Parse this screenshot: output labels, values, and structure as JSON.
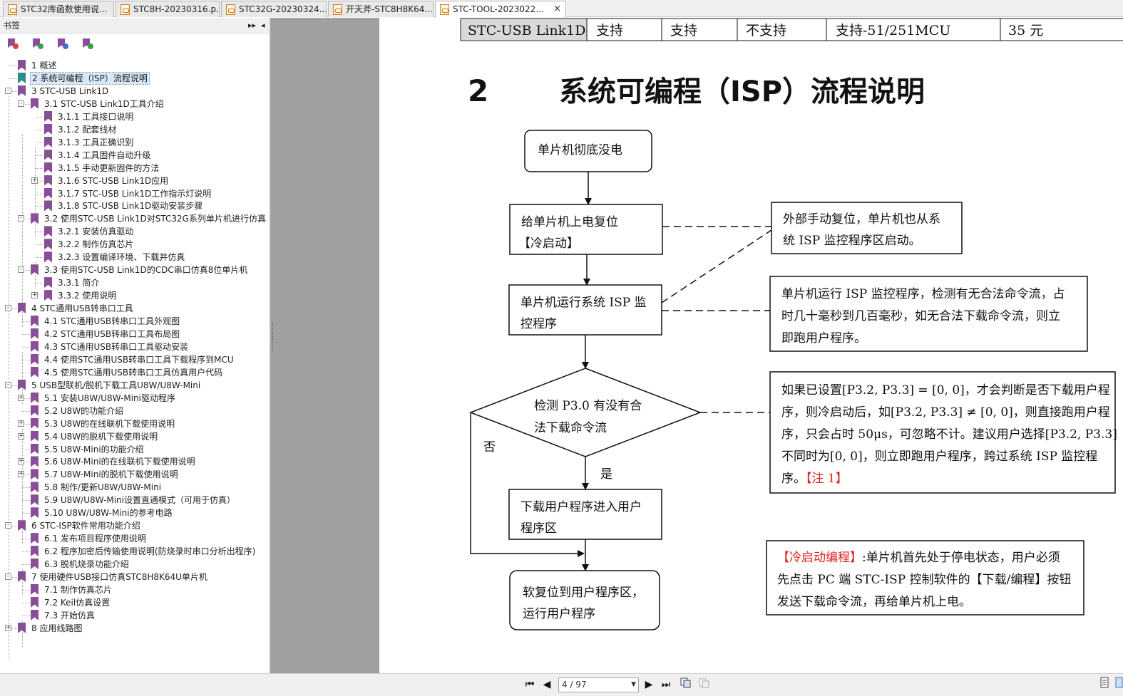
{
  "tabs": [
    {
      "label": "STC32库函数使用说..."
    },
    {
      "label": "STC8H-20230316.p..."
    },
    {
      "label": "STC32G-20230324..."
    },
    {
      "label": "开天斧-STC8H8K64..."
    },
    {
      "label": "STC-TOOL-2023022...",
      "active": true
    }
  ],
  "tab_close": "×",
  "sidebar": {
    "title": "书签",
    "header_btns": [
      "▸▸",
      "◂"
    ],
    "tools": [
      "delete-bookmark-icon",
      "add-bookmark-icon",
      "goto-bookmark-icon",
      "find-bookmark-icon"
    ],
    "items": [
      {
        "label": "1  概述"
      },
      {
        "label": "2 系统可编程（ISP）流程说明"
      },
      {
        "label": "3  STC-USB Link1D"
      },
      {
        "label": "3.1 STC-USB Link1D工具介绍"
      },
      {
        "label": "3.1.1 工具接口说明"
      },
      {
        "label": "3.1.2 配套线材"
      },
      {
        "label": "3.1.3 工具正确识别"
      },
      {
        "label": "3.1.4  工具固件自动升级"
      },
      {
        "label": "3.1.5   手动更新固件的方法"
      },
      {
        "label": "3.1.6   STC-USB Link1D应用"
      },
      {
        "label": "3.1.7   STC-USB Link1D工作指示灯说明"
      },
      {
        "label": "3.1.8   STC-USB Link1D驱动安装步骤"
      },
      {
        "label": "3.2  使用STC-USB Link1D对STC32G系列单片机进行仿真"
      },
      {
        "label": "3.2.1 安装仿真驱动"
      },
      {
        "label": "3.2.2  制作仿真芯片"
      },
      {
        "label": "3.2.3  设置编译环境、下载并仿真"
      },
      {
        "label": "3.3  使用STC-USB Link1D的CDC串口仿真8位单片机"
      },
      {
        "label": "3.3.1 简介"
      },
      {
        "label": "3.3.2 使用说明"
      },
      {
        "label": "4  STC通用USB转串口工具"
      },
      {
        "label": "4.1 STC通用USB转串口工具外观图"
      },
      {
        "label": "4.2  STC通用USB转串口工具布局图"
      },
      {
        "label": "4.3 STC通用USB转串口工具驱动安装"
      },
      {
        "label": "4.4 使用STC通用USB转串口工具下载程序到MCU"
      },
      {
        "label": "4.5 使用STC通用USB转串口工具仿真用户代码"
      },
      {
        "label": "5  USB型联机/脱机下载工具U8W/U8W-Mini"
      },
      {
        "label": "5.1  安装U8W/U8W-Mini驱动程序"
      },
      {
        "label": "5.2  U8W的功能介绍"
      },
      {
        "label": "5.3  U8W的在线联机下载使用说明"
      },
      {
        "label": "5.4  U8W的脱机下载使用说明"
      },
      {
        "label": "5.5  U8W-Mini的功能介绍"
      },
      {
        "label": "5.6 U8W-Mini的在线联机下载使用说明"
      },
      {
        "label": "5.7 U8W-Mini的脱机下载使用说明"
      },
      {
        "label": "5.8  制作/更新U8W/U8W-Mini"
      },
      {
        "label": "5.9  U8W/U8W-Mini设置直通模式（可用于仿真）"
      },
      {
        "label": "5.10  U8W/U8W-Mini的参考电路"
      },
      {
        "label": "6 STC-ISP软件常用功能介绍"
      },
      {
        "label": "6.1 发布项目程序使用说明"
      },
      {
        "label": "6.2  程序加密后传输使用说明(防烧录时串口分析出程序)"
      },
      {
        "label": "6.3 脱机烧录功能介绍"
      },
      {
        "label": "7  使用硬件USB接口仿真STC8H8K64U单片机"
      },
      {
        "label": "7.1 制作仿真芯片"
      },
      {
        "label": "7.2 Keil仿真设置"
      },
      {
        "label": "7.3 开始仿真"
      },
      {
        "label": "8  应用线路图"
      }
    ]
  },
  "document": {
    "table_row": [
      "STC-USB Link1D",
      "支持",
      "支持",
      "不支持",
      "支持-51/251MCU",
      "35 元"
    ],
    "heading_number": "2",
    "heading_text": "系统可编程（ISP）流程说明",
    "flow": {
      "start": "单片机彻底没电",
      "step1_line1": "给单片机上电复位",
      "step1_line2": "【冷启动】",
      "step2_line1": "单片机运行系统 ISP 监",
      "step2_line2": "控程序",
      "decision_line1": "检测 P3.0 有没有合",
      "decision_line2": "法下载命令流",
      "no_label": "否",
      "yes_label": "是",
      "step3_line1": "下载用户程序进入用户",
      "step3_line2": "程序区",
      "end_line1": "软复位到用户程序区，",
      "end_line2": "运行用户程序"
    },
    "notes": {
      "note1_line1": "外部手动复位，单片机也从系",
      "note1_line2": "统 ISP 监控程序区启动。",
      "note2_line1": "单片机运行 ISP 监控程序，检测有无合法命令流，占",
      "note2_line2": "时几十毫秒到几百毫秒，如无合法下载命令流，则立",
      "note2_line3": "即跑用户程序。",
      "note3_line1": "如果已设置[P3.2, P3.3] = [0, 0]，才会判断是否下载用户程",
      "note3_line2": "序，则冷启动后，如[P3.2, P3.3] ≠ [0, 0]，则直接跑用户程",
      "note3_line3": "序，只会占时 50μs，可忽略不计。建议用户选择[P3.2, P3.3]",
      "note3_line4": "不同时为[0, 0]，则立即跑用户程序，跨过系统 ISP 监控程",
      "note3_line5": "序。",
      "note3_red": "【注 1】",
      "note4_red": "【冷启动编程】",
      "note4_line1": ":单片机首先处于停电状态，用户必须",
      "note4_line2": "先点击 PC 端 STC-ISP 控制软件的【下载/编程】按钮",
      "note4_line3": "发送下载命令流，再给单片机上电。"
    }
  },
  "statusbar": {
    "page_value": "4 / 97",
    "nav": [
      "⏮",
      "◀",
      "▶",
      "⏭"
    ]
  },
  "colors": {
    "bookmark": "#8a4d9a",
    "bookmark_selected": "#2a8c8c",
    "red_text": "#e0201e",
    "gray_area": "#a0a0a0"
  }
}
